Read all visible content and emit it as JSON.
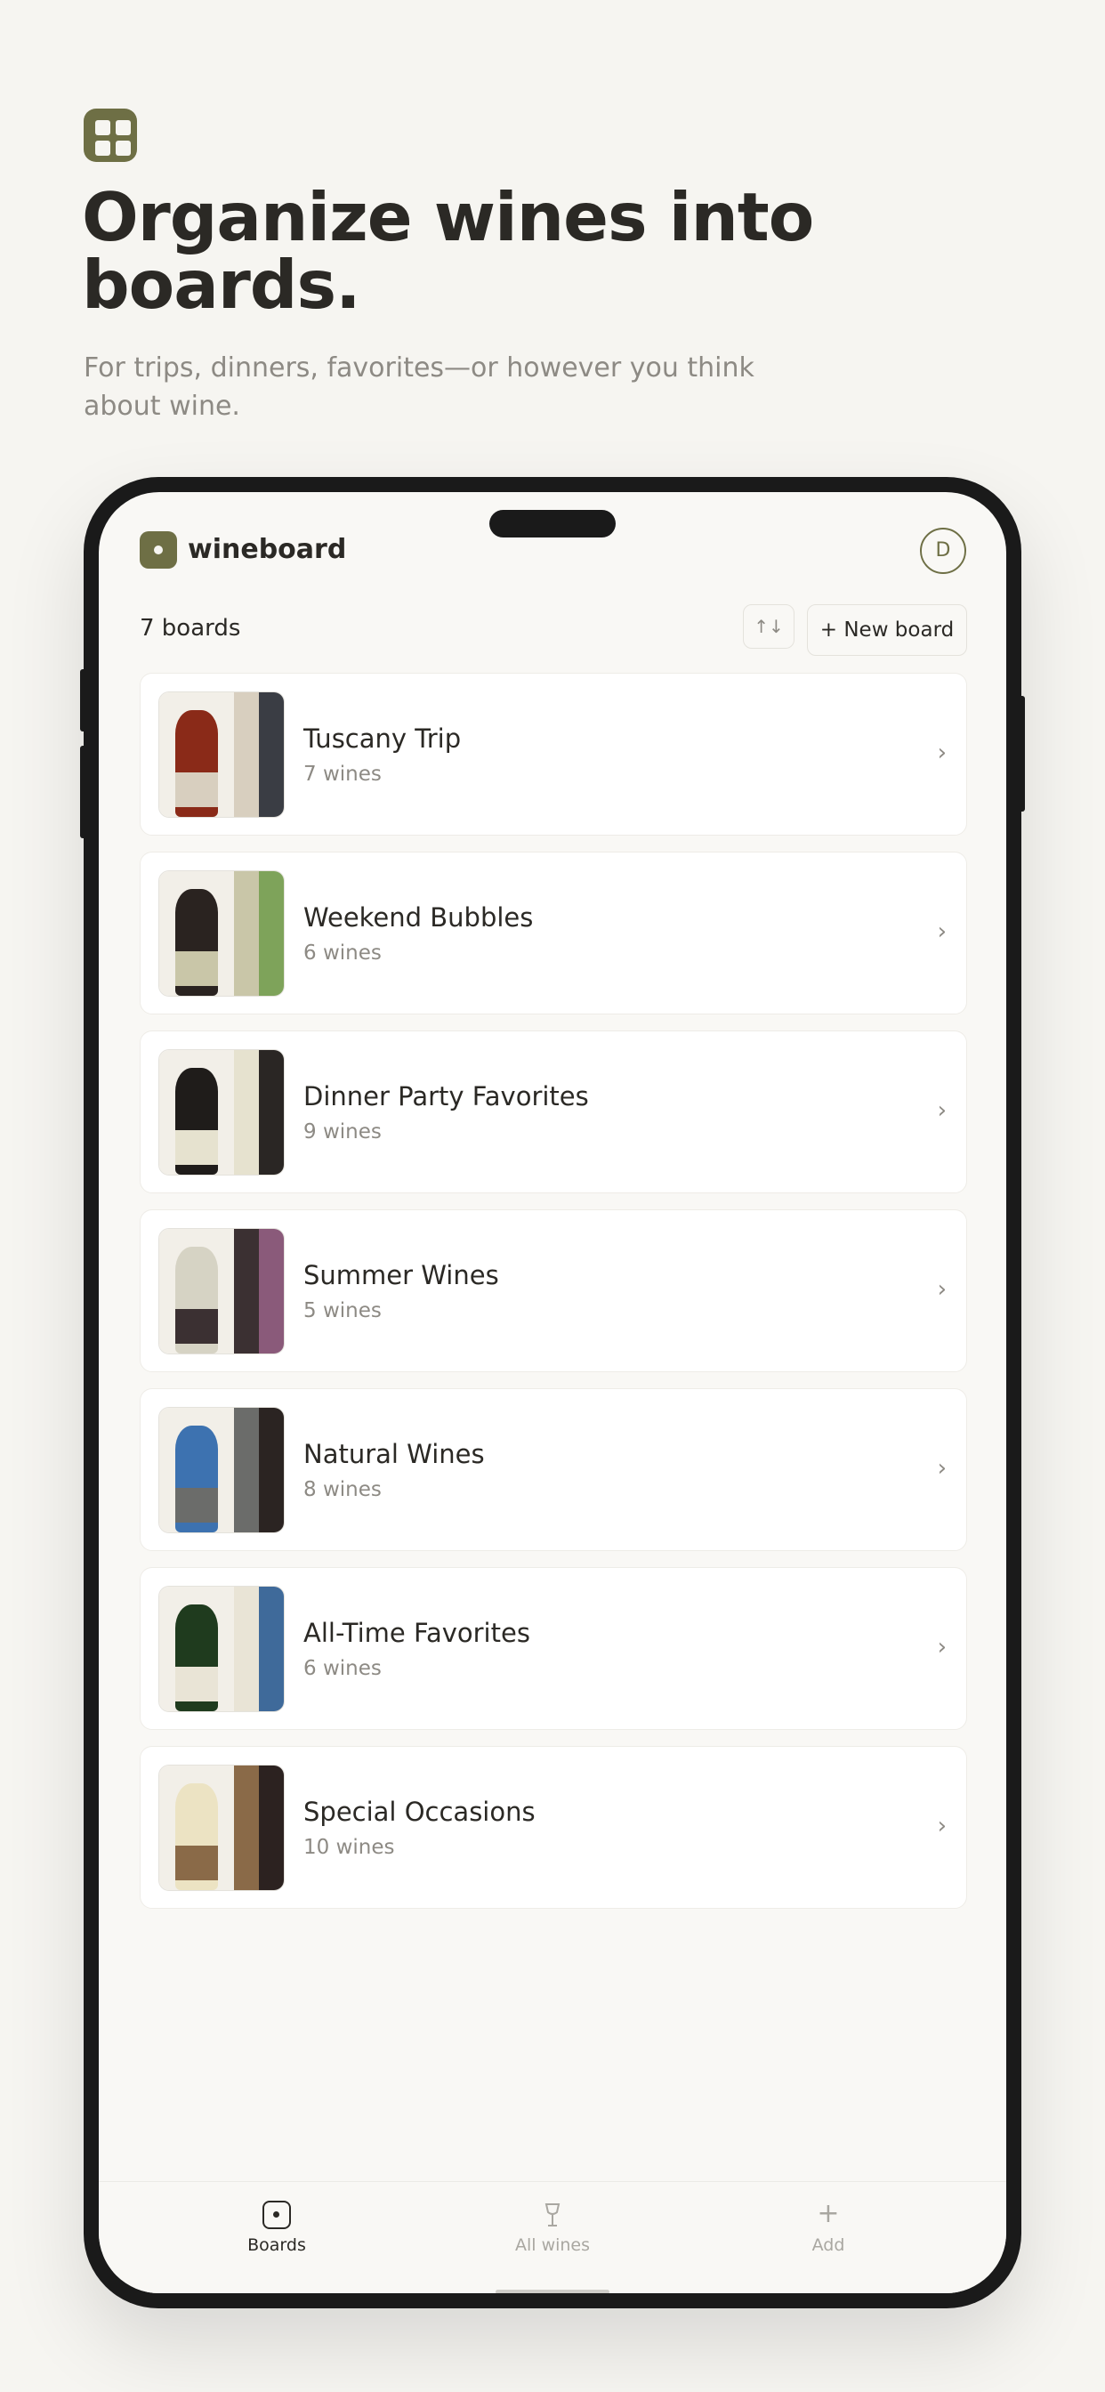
{
  "hero": {
    "title": "Organize wines into boards.",
    "subtitle": "For trips, dinners, favorites—or however you think about wine."
  },
  "app": {
    "brand": "wineboard",
    "avatar_initial": "D",
    "boards_count": "7 boards",
    "sort_icon": "↑↓",
    "new_board_label": "+ New board"
  },
  "boards": [
    {
      "title": "Tuscany Trip",
      "meta": "7 wines",
      "colors": [
        "#8a2a18",
        "#d8cfbf",
        "#3a3d44"
      ]
    },
    {
      "title": "Weekend Bubbles",
      "meta": "6 wines",
      "colors": [
        "#2a2320",
        "#c9c6a8",
        "#7ea35a"
      ]
    },
    {
      "title": "Dinner Party Favorites",
      "meta": "9 wines",
      "colors": [
        "#1f1c1a",
        "#e6e2cf",
        "#2a2624"
      ]
    },
    {
      "title": "Summer Wines",
      "meta": "5 wines",
      "colors": [
        "#d6d3c4",
        "#3b3032",
        "#8a5a7a"
      ]
    },
    {
      "title": "Natural Wines",
      "meta": "8 wines",
      "colors": [
        "#3d72b0",
        "#6b6c6a",
        "#2b2422"
      ]
    },
    {
      "title": "All-Time Favorites",
      "meta": "6 wines",
      "colors": [
        "#1f3b1e",
        "#e9e4d6",
        "#3f6a9a"
      ]
    },
    {
      "title": "Special Occasions",
      "meta": "10 wines",
      "colors": [
        "#ece3c3",
        "#8a6a48",
        "#2c2220"
      ]
    }
  ],
  "tabs": [
    {
      "label": "Boards",
      "icon": "boards-icon",
      "active": true
    },
    {
      "label": "All wines",
      "icon": "wine-glass-icon",
      "active": false
    },
    {
      "label": "Add",
      "icon": "plus-icon",
      "active": false
    }
  ],
  "tab_glyphs": {
    "wine": "🍷",
    "add": "+"
  },
  "colors": {
    "accent": "#6e6f45",
    "background": "#f6f5f1",
    "text": "#2b2925",
    "muted": "#8d8a84"
  }
}
